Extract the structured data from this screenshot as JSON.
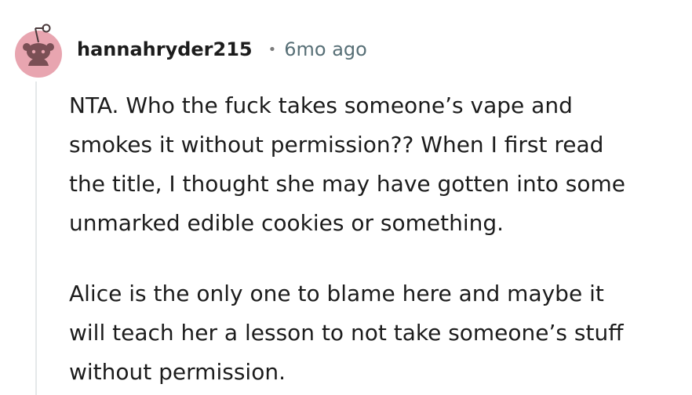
{
  "comment": {
    "author": "hannahryder215",
    "separator": "•",
    "timestamp": "6mo ago",
    "avatar_icon": "reddit-snoo-avatar-icon",
    "avatar_color": "#e8a5b0",
    "paragraphs": [
      [
        "NTA. Who the fuck takes someone’s vape and",
        "smokes it without permission?? When I first read",
        "the title, I thought she may have gotten into some",
        "unmarked edible cookies or something."
      ],
      [
        "Alice is the only one to blame here and maybe it",
        "will teach her a lesson to not take someone’s stuff",
        "without permission."
      ]
    ]
  },
  "colors": {
    "text": "#1c1c1c",
    "meta": "#576f76",
    "thread_line": "#e5e8ea",
    "avatar_bg": "#e8a5b0",
    "avatar_snoo": "#7a4f55"
  }
}
